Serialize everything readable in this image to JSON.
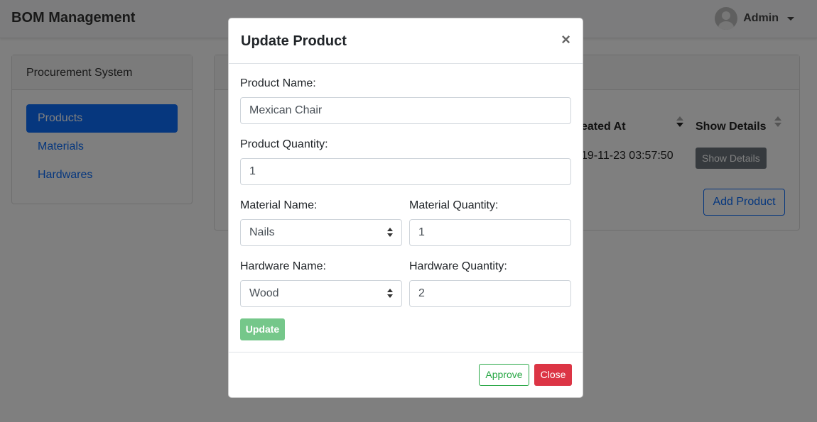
{
  "navbar": {
    "brand": "BOM Management",
    "user_name": "Admin"
  },
  "sidebar": {
    "title": "Procurement System",
    "items": [
      {
        "label": "Products",
        "active": true
      },
      {
        "label": "Materials",
        "active": false
      },
      {
        "label": "Hardwares",
        "active": false
      }
    ]
  },
  "table": {
    "headers": {
      "created_at": "eated At",
      "show_details": "Show Details"
    },
    "rows": [
      {
        "created_at": "19-11-23 03:57:50",
        "action": "Show Details"
      }
    ],
    "add_button": "Add Product"
  },
  "modal": {
    "title": "Update Product",
    "close_symbol": "×",
    "fields": {
      "product_name_label": "Product Name:",
      "product_name_value": "Mexican Chair",
      "product_quantity_label": "Product Quantity:",
      "product_quantity_value": "1",
      "material_name_label": "Material Name:",
      "material_name_value": "Nails",
      "material_quantity_label": "Material Quantity:",
      "material_quantity_value": "1",
      "hardware_name_label": "Hardware Name:",
      "hardware_name_value": "Wood",
      "hardware_quantity_label": "Hardware Quantity:",
      "hardware_quantity_value": "2"
    },
    "update_button": "Update",
    "approve_button": "Approve",
    "close_button": "Close"
  },
  "colors": {
    "primary": "#0d6efd",
    "success": "#28a745",
    "danger": "#dc3545",
    "secondary": "#6c757d"
  }
}
